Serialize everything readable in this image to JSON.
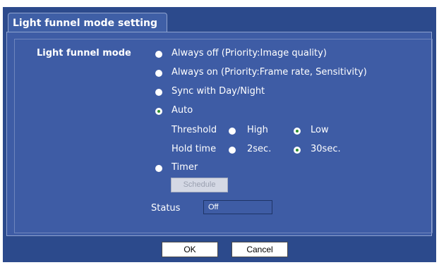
{
  "tab": {
    "title": "Light funnel mode setting"
  },
  "form": {
    "label": "Light funnel mode",
    "options": [
      {
        "label": "Always off (Priority:Image quality)",
        "checked": false
      },
      {
        "label": "Always on (Priority:Frame rate, Sensitivity)",
        "checked": false
      },
      {
        "label": "Sync with Day/Night",
        "checked": false
      },
      {
        "label": "Auto",
        "checked": true
      },
      {
        "label": "Timer",
        "checked": false
      }
    ],
    "threshold": {
      "label": "Threshold",
      "high": "High",
      "low": "Low",
      "selected": "Low"
    },
    "hold_time": {
      "label": "Hold time",
      "short": "2sec.",
      "long": "30sec.",
      "selected": "30sec."
    },
    "schedule_button": "Schedule",
    "status": {
      "label": "Status",
      "value": "Off"
    }
  },
  "buttons": {
    "ok": "OK",
    "cancel": "Cancel"
  },
  "colors": {
    "background": "#2c4a8c",
    "panel": "#3e5ca5",
    "text": "#ffffff",
    "radio_checked_dot": "#2f8f2f"
  }
}
